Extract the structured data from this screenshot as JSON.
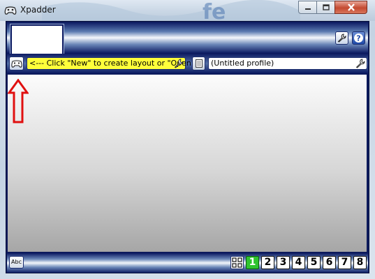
{
  "window": {
    "title": "Xpadder",
    "controls": {
      "minimize_icon": "minimize-icon",
      "maximize_icon": "maximize-icon",
      "close_icon": "close-icon"
    }
  },
  "header": {
    "image_thumbnail": "blank",
    "settings_icon": "wrench-icon",
    "help_icon": "question-mark-icon"
  },
  "toolbar": {
    "controller_icon": "gamepad-icon",
    "layout_text": "<--- Click \"New\" to create layout or \"Open\"",
    "layout_highlight_color": "#ffff3a",
    "profile_icon": "notepad-icon",
    "profile_text": "(Untitled profile)",
    "wrench_icon": "wrench-icon"
  },
  "annotation": {
    "type": "red-up-arrow",
    "color": "#e01010"
  },
  "footer": {
    "text_button_label": "Abc",
    "sets_icon": "sets-grid-icon",
    "set_buttons": [
      "1",
      "2",
      "3",
      "4",
      "5",
      "6",
      "7",
      "8"
    ],
    "active_set": "1",
    "active_color": "#2fc42f"
  },
  "colors": {
    "frame": "#0c1a5c",
    "close_button": "#c44a31"
  }
}
